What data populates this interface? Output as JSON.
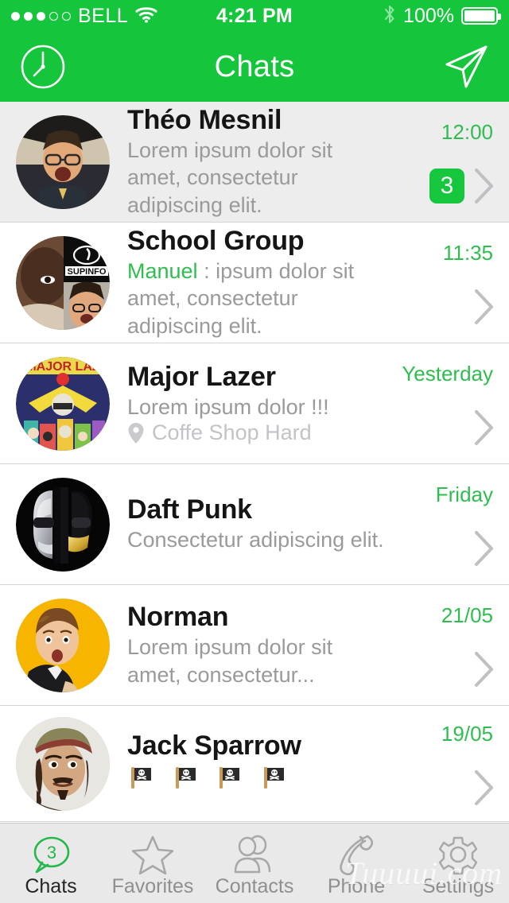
{
  "colors": {
    "brand_green": "#15C63C",
    "accent_green": "#2FBD4F",
    "unread_row_bg": "#EDEDED",
    "muted_gray": "#9A9A9A",
    "light_gray": "#C3C3C7"
  },
  "status_bar": {
    "signal_dots_filled": 3,
    "signal_dots_total": 5,
    "carrier": "BELL",
    "wifi_icon": "wifi-icon",
    "time": "4:21 PM",
    "bluetooth_icon": "bluetooth-icon",
    "battery_percent": "100%",
    "battery_icon": "battery-full-icon"
  },
  "navbar": {
    "left_icon": "clock-icon",
    "title": "Chats",
    "right_icon": "paper-plane-icon"
  },
  "chats": [
    {
      "name": "Théo Mesnil",
      "sender": "",
      "message": "Lorem ipsum dolor sit amet, consectetur adipiscing elit.",
      "time": "12:00",
      "badge": "3",
      "unread": true,
      "location": "",
      "avatar": "theo-mesnil-avatar"
    },
    {
      "name": "School Group",
      "sender": "Manuel",
      "message": ": ipsum dolor sit amet, consectetur adipiscing elit.",
      "time": "11:35",
      "badge": "",
      "unread": false,
      "location": "",
      "avatar": "school-group-avatar"
    },
    {
      "name": "Major Lazer",
      "sender": "",
      "message": "Lorem ipsum dolor !!!",
      "time": "Yesterday",
      "badge": "",
      "unread": false,
      "location": "Coffe Shop Hard",
      "avatar": "major-lazer-avatar"
    },
    {
      "name": "Daft Punk",
      "sender": "",
      "message": "Consectetur adipiscing elit.",
      "time": "Friday",
      "badge": "",
      "unread": false,
      "location": "",
      "avatar": "daft-punk-avatar"
    },
    {
      "name": "Norman",
      "sender": "",
      "message": "Lorem ipsum dolor sit amet, consectetur...",
      "time": "21/05",
      "badge": "",
      "unread": false,
      "location": "",
      "avatar": "norman-avatar"
    },
    {
      "name": "Jack Sparrow",
      "sender": "",
      "message": "",
      "time": "19/05",
      "badge": "",
      "unread": false,
      "location": "",
      "flags": 4,
      "avatar": "jack-sparrow-avatar"
    }
  ],
  "tabbar": {
    "items": [
      {
        "label": "Chats",
        "icon": "chat-bubble-icon",
        "badge": "3",
        "active": true
      },
      {
        "label": "Favorites",
        "icon": "star-icon",
        "badge": "",
        "active": false
      },
      {
        "label": "Contacts",
        "icon": "contacts-icon",
        "badge": "",
        "active": false
      },
      {
        "label": "Phone",
        "icon": "phone-handset-icon",
        "badge": "",
        "active": false
      },
      {
        "label": "Settings",
        "icon": "gear-icon",
        "badge": "",
        "active": false
      }
    ]
  },
  "watermark": "Tuuuui.com"
}
